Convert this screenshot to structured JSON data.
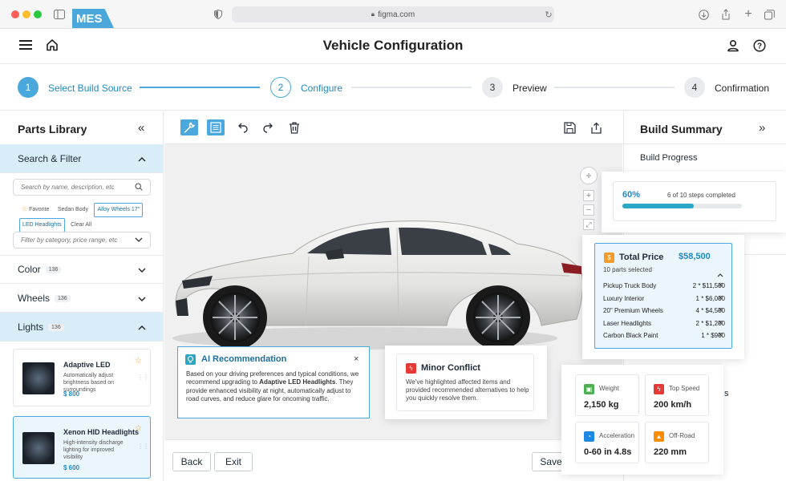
{
  "browser": {
    "url": "figma.com"
  },
  "header": {
    "logo": "MES",
    "title": "Vehicle Configuration"
  },
  "stepper": [
    {
      "num": "1",
      "label": "Select Build Source"
    },
    {
      "num": "2",
      "label": "Configure"
    },
    {
      "num": "3",
      "label": "Preview"
    },
    {
      "num": "4",
      "label": "Confirmation"
    }
  ],
  "parts": {
    "title": "Parts Library",
    "search_filter": "Search & Filter",
    "search_placeholder": "Search by name, description, etc",
    "chips": [
      "Favorite",
      "Sedan Body",
      "Alloy Wheels 17\"",
      "LED Headlights",
      "Clear All"
    ],
    "filter_placeholder": "Filter by category, price range, etc",
    "categories": [
      {
        "label": "Color",
        "count": "136"
      },
      {
        "label": "Wheels",
        "count": "136"
      },
      {
        "label": "Lights",
        "count": "136"
      }
    ],
    "items": [
      {
        "name": "Adaptive LED",
        "desc": "Automatically adjust brightness based on surroundings",
        "price": "$ 800"
      },
      {
        "name": "Xenon HID Headlights",
        "desc": "High-intensity discharge lighting for improved visibility",
        "price": "$ 600"
      }
    ]
  },
  "bottom": {
    "back": "Back",
    "exit": "Exit",
    "save": "Save"
  },
  "ai": {
    "title": "AI Recommendation",
    "text_before": "Based on your driving preferences and typical conditions, we recommend upgrading to ",
    "text_bold": "Adaptive LED Headlights",
    "text_after": ". They provide enhanced visibility at night, automatically adjust to road curves, and reduce glare for oncoming traffic."
  },
  "conflict": {
    "title": "Minor Conflict",
    "text": "We've highlighted affected items and provided recommended alternatives to help you quickly resolve them."
  },
  "summary": {
    "title": "Build Summary",
    "progress_label": "Build Progress",
    "percent": "60%",
    "progress_value": 0.6,
    "steps_text": "6 of 10 steps completed",
    "partial_text": "s"
  },
  "price": {
    "title": "Total Price",
    "total": "$58,500",
    "selected": "10 parts selected",
    "items": [
      {
        "name": "Pickup Truck Body",
        "qty": "2 * $11,500"
      },
      {
        "name": "Luxury Interior",
        "qty": "1 * $6,000"
      },
      {
        "name": "20\" Premium Wheels",
        "qty": "4 * $4,500"
      },
      {
        "name": "Laser Headlights",
        "qty": "2 * $1,200"
      },
      {
        "name": "Carbon Black Paint",
        "qty": "1 * $900"
      }
    ]
  },
  "stats": [
    {
      "label": "Weight",
      "value": "2,150 kg",
      "color": "#4caf50"
    },
    {
      "label": "Top Speed",
      "value": "200 km/h",
      "color": "#e53935"
    },
    {
      "label": "Acceleration",
      "value": "0-60 in 4.8s",
      "color": "#1e88e5"
    },
    {
      "label": "Off-Road",
      "value": "220 mm",
      "color": "#fb8c00"
    }
  ],
  "colors": {
    "accent": "#4aa8dc",
    "accent_dark": "#1f8ac2"
  }
}
